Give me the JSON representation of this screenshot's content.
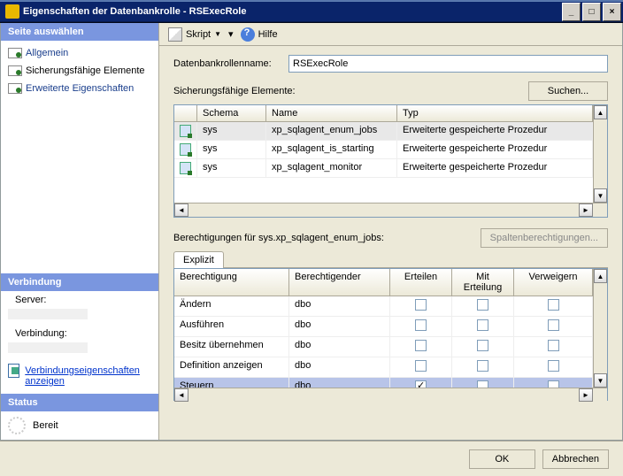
{
  "title": "Eigenschaften der Datenbankrolle - RSExecRole",
  "sidebar": {
    "header": "Seite auswählen",
    "items": [
      {
        "label": "Allgemein"
      },
      {
        "label": "Sicherungsfähige Elemente"
      },
      {
        "label": "Erweiterte Eigenschaften"
      }
    ],
    "verbindung_header": "Verbindung",
    "server_label": "Server:",
    "verbindung_label": "Verbindung:",
    "link_text": "Verbindungseigenschaften anzeigen",
    "status_header": "Status",
    "status_text": "Bereit"
  },
  "toolbar": {
    "script": "Skript",
    "help": "Hilfe"
  },
  "form": {
    "rolename_label": "Datenbankrollenname:",
    "rolename_value": "RSExecRole",
    "securables_label": "Sicherungsfähige Elemente:",
    "search_btn": "Suchen..."
  },
  "grid1": {
    "headers": {
      "schema": "Schema",
      "name": "Name",
      "typ": "Typ"
    },
    "rows": [
      {
        "schema": "sys",
        "name": "xp_sqlagent_enum_jobs",
        "typ": "Erweiterte gespeicherte Prozedur"
      },
      {
        "schema": "sys",
        "name": "xp_sqlagent_is_starting",
        "typ": "Erweiterte gespeicherte Prozedur"
      },
      {
        "schema": "sys",
        "name": "xp_sqlagent_monitor",
        "typ": "Erweiterte gespeicherte Prozedur"
      }
    ]
  },
  "perms": {
    "label": "Berechtigungen für sys.xp_sqlagent_enum_jobs:",
    "col_perms_btn": "Spaltenberechtigungen...",
    "tab": "Explizit",
    "headers": {
      "perm": "Berechtigung",
      "by": "Berechtigender",
      "grant": "Erteilen",
      "withgrant": "Mit Erteilung",
      "deny": "Verweigern"
    },
    "rows": [
      {
        "perm": "Ändern",
        "by": "dbo",
        "grant": false,
        "withgrant": false,
        "deny": false
      },
      {
        "perm": "Ausführen",
        "by": "dbo",
        "grant": false,
        "withgrant": false,
        "deny": false
      },
      {
        "perm": "Besitz übernehmen",
        "by": "dbo",
        "grant": false,
        "withgrant": false,
        "deny": false
      },
      {
        "perm": "Definition anzeigen",
        "by": "dbo",
        "grant": false,
        "withgrant": false,
        "deny": false
      },
      {
        "perm": "Steuern",
        "by": "dbo",
        "grant": true,
        "withgrant": false,
        "deny": false
      }
    ]
  },
  "footer": {
    "ok": "OK",
    "cancel": "Abbrechen"
  }
}
